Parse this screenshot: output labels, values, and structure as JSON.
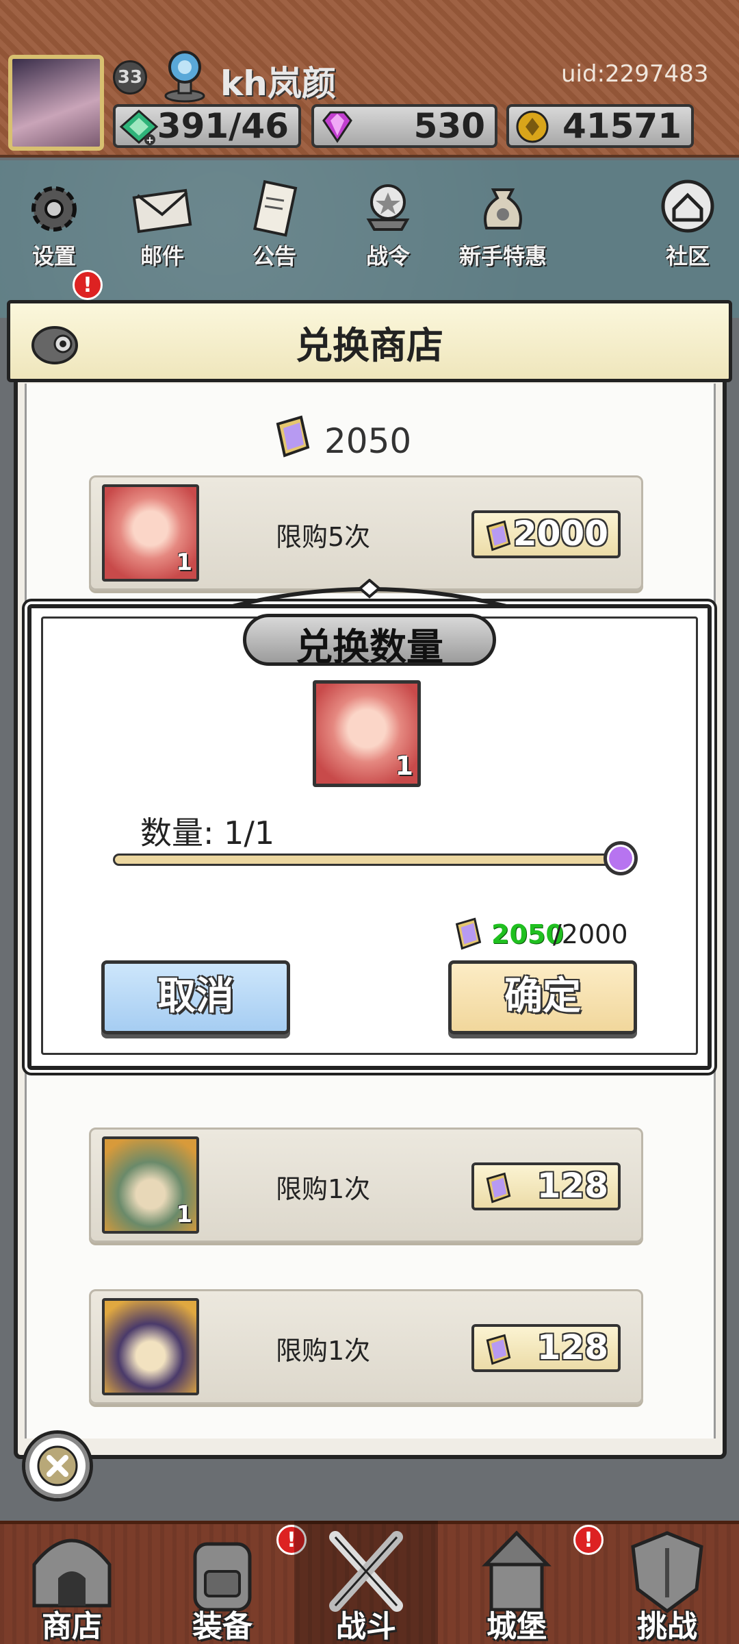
{
  "header": {
    "level": "33",
    "player_name": "kh岚颜",
    "uid": "uid:2297483",
    "resources": {
      "energy": "391/46",
      "gems": "530",
      "gold": "41571"
    }
  },
  "top_menu": {
    "settings": "设置",
    "mail": "邮件",
    "notice": "公告",
    "battle_pass": "战令",
    "newbie_deals": "新手特惠",
    "community": "社区"
  },
  "shop": {
    "title": "兑换商店",
    "balance": "2050",
    "items": [
      {
        "limit": "限购5次",
        "price": "2000",
        "qty": "1"
      },
      {
        "limit": "限购1次",
        "price": "128",
        "qty": "1"
      },
      {
        "limit": "限购1次",
        "price": "128",
        "qty": ""
      }
    ]
  },
  "dialog": {
    "title": "兑换数量",
    "item_qty": "1",
    "quantity_label": "数量:",
    "quantity_value": "1/1",
    "slider": {
      "value": 1,
      "max": 1
    },
    "cost_have": "2050",
    "cost_need": "/2000",
    "cancel_label": "取消",
    "confirm_label": "确定"
  },
  "bottom_nav": {
    "shop": "商店",
    "equipment": "装备",
    "battle": "战斗",
    "castle": "城堡",
    "challenge": "挑战"
  },
  "colors": {
    "header_bg": "#9a5a3a",
    "cancel_button": "#a6cdf2",
    "confirm_button": "#f1d79c",
    "slider_thumb": "#b774f0",
    "cost_have_green": "#20c020"
  },
  "icons": [
    "gear-icon",
    "mail-icon",
    "scroll-icon",
    "battle-pass-icon",
    "money-bag-icon",
    "home-icon",
    "book-currency-icon",
    "diamond-icon",
    "gold-coin-icon",
    "energy-icon",
    "close-icon"
  ]
}
